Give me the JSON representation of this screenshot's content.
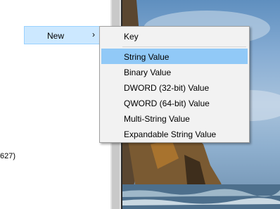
{
  "left_pane": {
    "partial_text": "627)"
  },
  "context_menu": {
    "parent_item_label": "New",
    "parent_arrow": "›",
    "items": [
      {
        "label": "Key"
      },
      {
        "label": "String Value",
        "highlighted": true
      },
      {
        "label": "Binary Value"
      },
      {
        "label": "DWORD (32-bit) Value"
      },
      {
        "label": "QWORD (64-bit) Value"
      },
      {
        "label": "Multi-String Value"
      },
      {
        "label": "Expandable String Value"
      }
    ]
  },
  "colors": {
    "highlight": "#91c9f7",
    "menu_background": "#f2f2f2",
    "parent_highlight": "#cce8ff"
  }
}
